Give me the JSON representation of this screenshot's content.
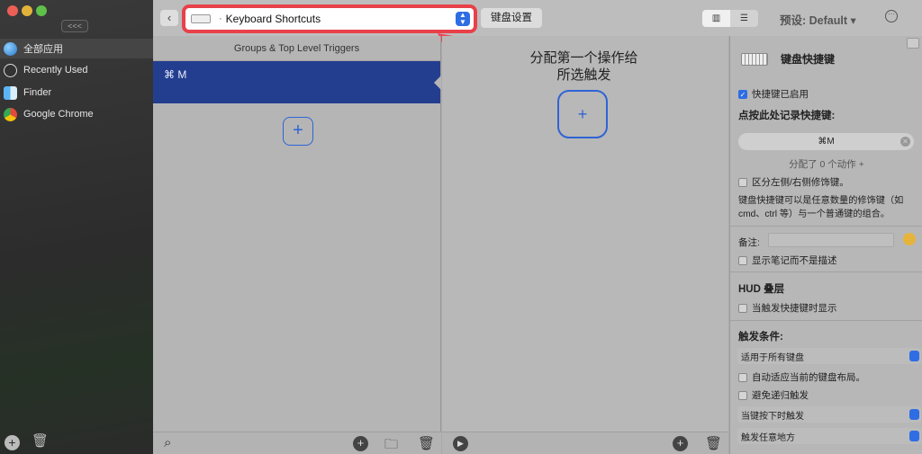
{
  "sidebar": {
    "collapse_label": "<<<",
    "apps": [
      {
        "label": "全部应用",
        "icon": "globe-icon"
      },
      {
        "label": "Recently Used",
        "icon": "clock-icon"
      },
      {
        "label": "Finder",
        "icon": "finder-icon"
      },
      {
        "label": "Google Chrome",
        "icon": "chrome-icon"
      }
    ]
  },
  "toolbar": {
    "back_label": "‹",
    "trigger_type": "Keyboard Shortcuts",
    "trigger_dot": "·",
    "keyboard_settings": "键盘设置",
    "preset": "预设: Default ▾",
    "more_label": "···"
  },
  "groups": {
    "header": "Groups & Top Level Triggers",
    "selected_shortcut": "⌘ M",
    "add_label": "+"
  },
  "actions": {
    "hint_line1": "分配第一个操作给",
    "hint_line2": "所选触发",
    "add_label": "+"
  },
  "inspector": {
    "title": "键盘快捷键",
    "enabled_label": "快捷键已启用",
    "record_title": "点按此处记录快捷键:",
    "shortcut_value": "⌘M",
    "assigned_actions": "分配了 0 个动作 +",
    "distinguish_label": "区分左侧/右侧修饰键。",
    "description": "键盘快捷键可以是任意数量的修饰键（如 cmd、ctrl 等）与一个普通键的组合。",
    "notes_label": "备注:",
    "notes_value": "",
    "show_notes_label": "显示笔记而不是描述",
    "hud_title": "HUD 叠层",
    "hud_label": "当触发快捷键时显示",
    "conditions_title": "触发条件:",
    "keyboard_select": "适用于所有键盘",
    "auto_adapt_label": "自动适应当前的键盘布局。",
    "avoid_recursive_label": "避免递归触发",
    "key_press_select": "当键按下时触发",
    "anywhere_select": "触发任意地方"
  }
}
